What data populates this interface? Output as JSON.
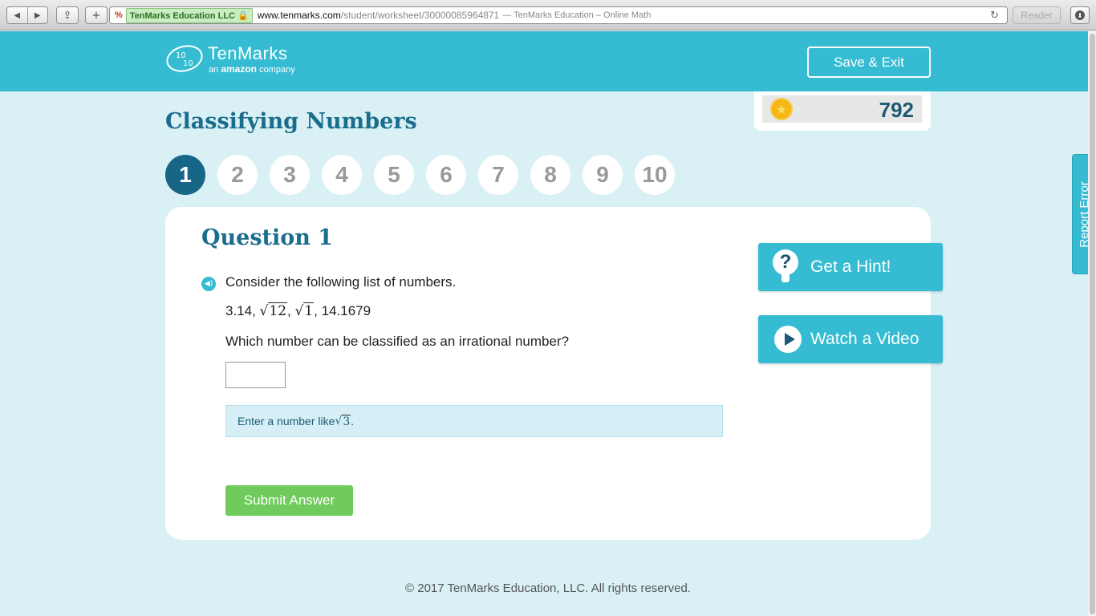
{
  "browser": {
    "site_identity": "TenMarks Education LLC",
    "url_host": "www.tenmarks.com",
    "url_path": "/student/worksheet/30000085964871",
    "page_title": "— TenMarks Education – Online Math",
    "reader_label": "Reader"
  },
  "header": {
    "brand": "TenMarks",
    "tagline_pre": "an",
    "tagline_amazon": "amazon",
    "tagline_post": "company",
    "save_exit_label": "Save & Exit"
  },
  "score": {
    "value": "792",
    "accent": "#f6b616"
  },
  "page_title": "Classifying Numbers",
  "question_nav": {
    "active": 1,
    "items": [
      "1",
      "2",
      "3",
      "4",
      "5",
      "6",
      "7",
      "8",
      "9",
      "10"
    ]
  },
  "question": {
    "heading": "Question 1",
    "prompt": "Consider the following list of numbers.",
    "list": {
      "n1": "3.14, ",
      "r1": "12",
      "sep1": ", ",
      "r2": "1",
      "sep2": ", ",
      "n2": "14.1679"
    },
    "ask": "Which number can be classified as an irrational number?",
    "answer_value": "",
    "hint_pre": "Enter a number like ",
    "hint_radicand": "3",
    "hint_post": "."
  },
  "actions": {
    "submit_label": "Submit Answer",
    "hint_label": "Get a Hint!",
    "video_label": "Watch a Video",
    "report_label": "Report Error"
  },
  "footer": "© 2017 TenMarks Education, LLC. All rights reserved.",
  "colors": {
    "header_bg": "#35bcd2",
    "page_bg": "#d9f0f5",
    "title": "#1b6d8d",
    "active_step": "#176587",
    "submit": "#6fcb5b"
  }
}
